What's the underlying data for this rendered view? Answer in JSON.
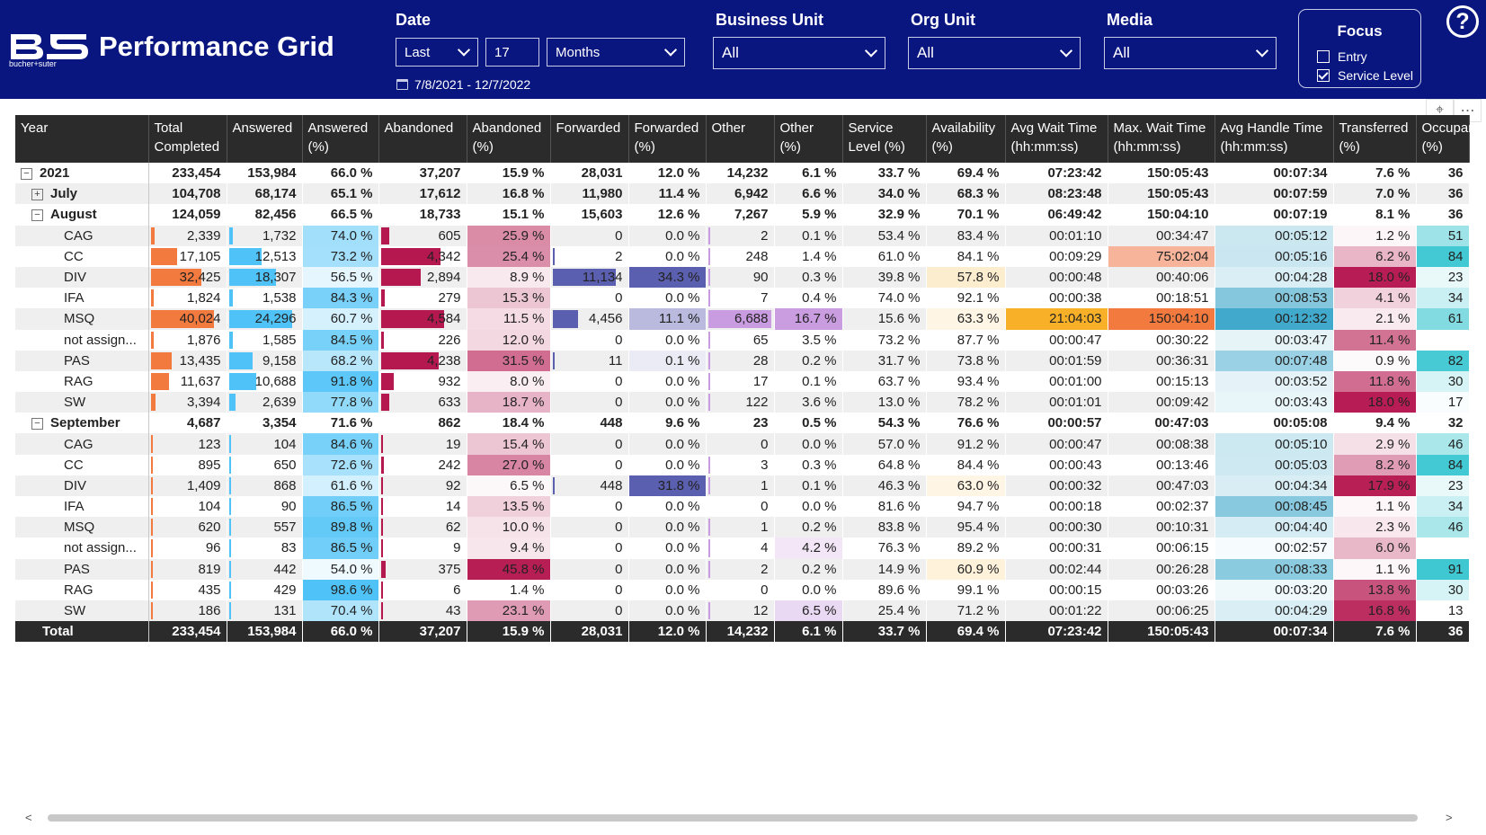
{
  "header": {
    "app_title": "Performance Grid",
    "logo_icon": "bucher-suter-logo",
    "logo_text": "bucher+suter",
    "date": {
      "label": "Date",
      "mode": "Last",
      "count": "17",
      "unit": "Months",
      "range": "7/8/2021 - 12/7/2022"
    },
    "business_unit": {
      "label": "Business Unit",
      "value": "All"
    },
    "org_unit": {
      "label": "Org Unit",
      "value": "All"
    },
    "media": {
      "label": "Media",
      "value": "All"
    },
    "focus": {
      "title": "Focus",
      "options": [
        {
          "label": "Entry",
          "checked": false
        },
        {
          "label": "Service Level",
          "checked": true
        }
      ]
    },
    "help_label": "?"
  },
  "table": {
    "columns": [
      "Year",
      "Total Completed",
      "Answered",
      "Answered (%)",
      "Abandoned",
      "Abandoned (%)",
      "Forwarded",
      "Forwarded (%)",
      "Other",
      "Other (%)",
      "Service Level (%)",
      "Availability (%)",
      "Avg Wait Time (hh:mm:ss)",
      "Max. Wait Time (hh:mm:ss)",
      "Avg Handle Time (hh:mm:ss)",
      "Transferred (%)",
      "Occupancy (%)"
    ],
    "rows": [
      {
        "level": 0,
        "expand": "−",
        "label": "2021",
        "cells": [
          "233,454",
          "153,984",
          "66.0 %",
          "37,207",
          "15.9 %",
          "28,031",
          "12.0 %",
          "14,232",
          "6.1 %",
          "33.7 %",
          "69.4 %",
          "07:23:42",
          "150:05:43",
          "00:07:34",
          "7.6 %",
          "36"
        ]
      },
      {
        "level": 1,
        "expand": "+",
        "label": "July",
        "cells": [
          "104,708",
          "68,174",
          "65.1 %",
          "17,612",
          "16.8 %",
          "11,980",
          "11.4 %",
          "6,942",
          "6.6 %",
          "34.0 %",
          "68.3 %",
          "08:23:48",
          "150:05:43",
          "00:07:59",
          "7.0 %",
          "36"
        ]
      },
      {
        "level": 1,
        "expand": "−",
        "label": "August",
        "cells": [
          "124,059",
          "82,456",
          "66.5 %",
          "18,733",
          "15.1 %",
          "15,603",
          "12.6 %",
          "7,267",
          "5.9 %",
          "32.9 %",
          "70.1 %",
          "06:49:42",
          "150:04:10",
          "00:07:19",
          "8.1 %",
          "36"
        ]
      },
      {
        "level": 2,
        "label": "CAG",
        "cells": [
          "2,339",
          "1,732",
          "74.0 %",
          "605",
          "25.9 %",
          "0",
          "0.0 %",
          "2",
          "0.1 %",
          "53.4 %",
          "83.4 %",
          "00:01:10",
          "00:34:47",
          "00:05:12",
          "1.2 %",
          "51"
        ]
      },
      {
        "level": 2,
        "label": "CC",
        "cells": [
          "17,105",
          "12,513",
          "73.2 %",
          "4,342",
          "25.4 %",
          "2",
          "0.0 %",
          "248",
          "1.4 %",
          "61.0 %",
          "84.1 %",
          "00:09:29",
          "75:02:04",
          "00:05:16",
          "6.2 %",
          "84"
        ]
      },
      {
        "level": 2,
        "label": "DIV",
        "cells": [
          "32,425",
          "18,307",
          "56.5 %",
          "2,894",
          "8.9 %",
          "11,134",
          "34.3 %",
          "90",
          "0.3 %",
          "39.8 %",
          "57.8 %",
          "00:00:48",
          "00:40:06",
          "00:04:28",
          "18.0 %",
          "23"
        ]
      },
      {
        "level": 2,
        "label": "IFA",
        "cells": [
          "1,824",
          "1,538",
          "84.3 %",
          "279",
          "15.3 %",
          "0",
          "0.0 %",
          "7",
          "0.4 %",
          "74.0 %",
          "92.1 %",
          "00:00:38",
          "00:18:51",
          "00:08:53",
          "4.1 %",
          "34"
        ]
      },
      {
        "level": 2,
        "label": "MSQ",
        "cells": [
          "40,024",
          "24,296",
          "60.7 %",
          "4,584",
          "11.5 %",
          "4,456",
          "11.1 %",
          "6,688",
          "16.7 %",
          "15.6 %",
          "63.3 %",
          "21:04:03",
          "150:04:10",
          "00:12:32",
          "2.1 %",
          "61"
        ]
      },
      {
        "level": 2,
        "label": "not assign...",
        "cells": [
          "1,876",
          "1,585",
          "84.5 %",
          "226",
          "12.0 %",
          "0",
          "0.0 %",
          "65",
          "3.5 %",
          "73.2 %",
          "87.7 %",
          "00:00:47",
          "00:30:22",
          "00:03:47",
          "11.4 %",
          ""
        ]
      },
      {
        "level": 2,
        "label": "PAS",
        "cells": [
          "13,435",
          "9,158",
          "68.2 %",
          "4,238",
          "31.5 %",
          "11",
          "0.1 %",
          "28",
          "0.2 %",
          "31.7 %",
          "73.8 %",
          "00:01:59",
          "00:36:31",
          "00:07:48",
          "0.9 %",
          "82"
        ]
      },
      {
        "level": 2,
        "label": "RAG",
        "cells": [
          "11,637",
          "10,688",
          "91.8 %",
          "932",
          "8.0 %",
          "0",
          "0.0 %",
          "17",
          "0.1 %",
          "63.7 %",
          "93.4 %",
          "00:01:00",
          "00:15:13",
          "00:03:52",
          "11.8 %",
          "30"
        ]
      },
      {
        "level": 2,
        "label": "SW",
        "cells": [
          "3,394",
          "2,639",
          "77.8 %",
          "633",
          "18.7 %",
          "0",
          "0.0 %",
          "122",
          "3.6 %",
          "13.0 %",
          "78.2 %",
          "00:01:01",
          "00:09:42",
          "00:03:43",
          "18.0 %",
          "17"
        ]
      },
      {
        "level": 1,
        "expand": "−",
        "label": "September",
        "cells": [
          "4,687",
          "3,354",
          "71.6 %",
          "862",
          "18.4 %",
          "448",
          "9.6 %",
          "23",
          "0.5 %",
          "54.3 %",
          "76.6 %",
          "00:00:57",
          "00:47:03",
          "00:05:08",
          "9.4 %",
          "32"
        ]
      },
      {
        "level": 2,
        "label": "CAG",
        "cells": [
          "123",
          "104",
          "84.6 %",
          "19",
          "15.4 %",
          "0",
          "0.0 %",
          "0",
          "0.0 %",
          "57.0 %",
          "91.2 %",
          "00:00:47",
          "00:08:38",
          "00:05:10",
          "2.9 %",
          "46"
        ]
      },
      {
        "level": 2,
        "label": "CC",
        "cells": [
          "895",
          "650",
          "72.6 %",
          "242",
          "27.0 %",
          "0",
          "0.0 %",
          "3",
          "0.3 %",
          "64.8 %",
          "84.4 %",
          "00:00:43",
          "00:13:46",
          "00:05:03",
          "8.2 %",
          "84"
        ]
      },
      {
        "level": 2,
        "label": "DIV",
        "cells": [
          "1,409",
          "868",
          "61.6 %",
          "92",
          "6.5 %",
          "448",
          "31.8 %",
          "1",
          "0.1 %",
          "46.3 %",
          "63.0 %",
          "00:00:32",
          "00:47:03",
          "00:04:34",
          "17.9 %",
          "23"
        ]
      },
      {
        "level": 2,
        "label": "IFA",
        "cells": [
          "104",
          "90",
          "86.5 %",
          "14",
          "13.5 %",
          "0",
          "0.0 %",
          "0",
          "0.0 %",
          "81.6 %",
          "94.7 %",
          "00:00:18",
          "00:02:37",
          "00:08:45",
          "1.1 %",
          "34"
        ]
      },
      {
        "level": 2,
        "label": "MSQ",
        "cells": [
          "620",
          "557",
          "89.8 %",
          "62",
          "10.0 %",
          "0",
          "0.0 %",
          "1",
          "0.2 %",
          "83.8 %",
          "95.4 %",
          "00:00:30",
          "00:10:31",
          "00:04:40",
          "2.3 %",
          "46"
        ]
      },
      {
        "level": 2,
        "label": "not assign...",
        "cells": [
          "96",
          "83",
          "86.5 %",
          "9",
          "9.4 %",
          "0",
          "0.0 %",
          "4",
          "4.2 %",
          "76.3 %",
          "89.2 %",
          "00:00:31",
          "00:06:15",
          "00:02:57",
          "6.0 %",
          ""
        ]
      },
      {
        "level": 2,
        "label": "PAS",
        "cells": [
          "819",
          "442",
          "54.0 %",
          "375",
          "45.8 %",
          "0",
          "0.0 %",
          "2",
          "0.2 %",
          "14.9 %",
          "60.9 %",
          "00:02:44",
          "00:26:28",
          "00:08:33",
          "1.1 %",
          "91"
        ]
      },
      {
        "level": 2,
        "label": "RAG",
        "cells": [
          "435",
          "429",
          "98.6 %",
          "6",
          "1.4 %",
          "0",
          "0.0 %",
          "0",
          "0.0 %",
          "89.6 %",
          "99.1 %",
          "00:00:15",
          "00:03:26",
          "00:03:20",
          "13.8 %",
          "30"
        ]
      },
      {
        "level": 2,
        "label": "SW",
        "cells": [
          "186",
          "131",
          "70.4 %",
          "43",
          "23.1 %",
          "0",
          "0.0 %",
          "12",
          "6.5 %",
          "25.4 %",
          "71.2 %",
          "00:01:22",
          "00:06:25",
          "00:04:29",
          "16.8 %",
          "13"
        ]
      }
    ],
    "total": {
      "label": "Total",
      "cells": [
        "233,454",
        "153,984",
        "66.0 %",
        "37,207",
        "15.9 %",
        "28,031",
        "12.0 %",
        "14,232",
        "6.1 %",
        "33.7 %",
        "69.4 %",
        "07:23:42",
        "150:05:43",
        "00:07:34",
        "7.6 %",
        "36"
      ]
    }
  },
  "colors": {
    "header_bg": "#0a1680",
    "bar_total_completed": "#f27a3e",
    "bar_answered": "#4fc3f7",
    "bar_abandoned": "#b5174f",
    "bar_forwarded": "#5b5fb0",
    "bar_other": "#c99be0",
    "table_header_bg": "#2b2b2b"
  },
  "scrollbar": {
    "left_arrow": "<",
    "right_arrow": ">"
  }
}
